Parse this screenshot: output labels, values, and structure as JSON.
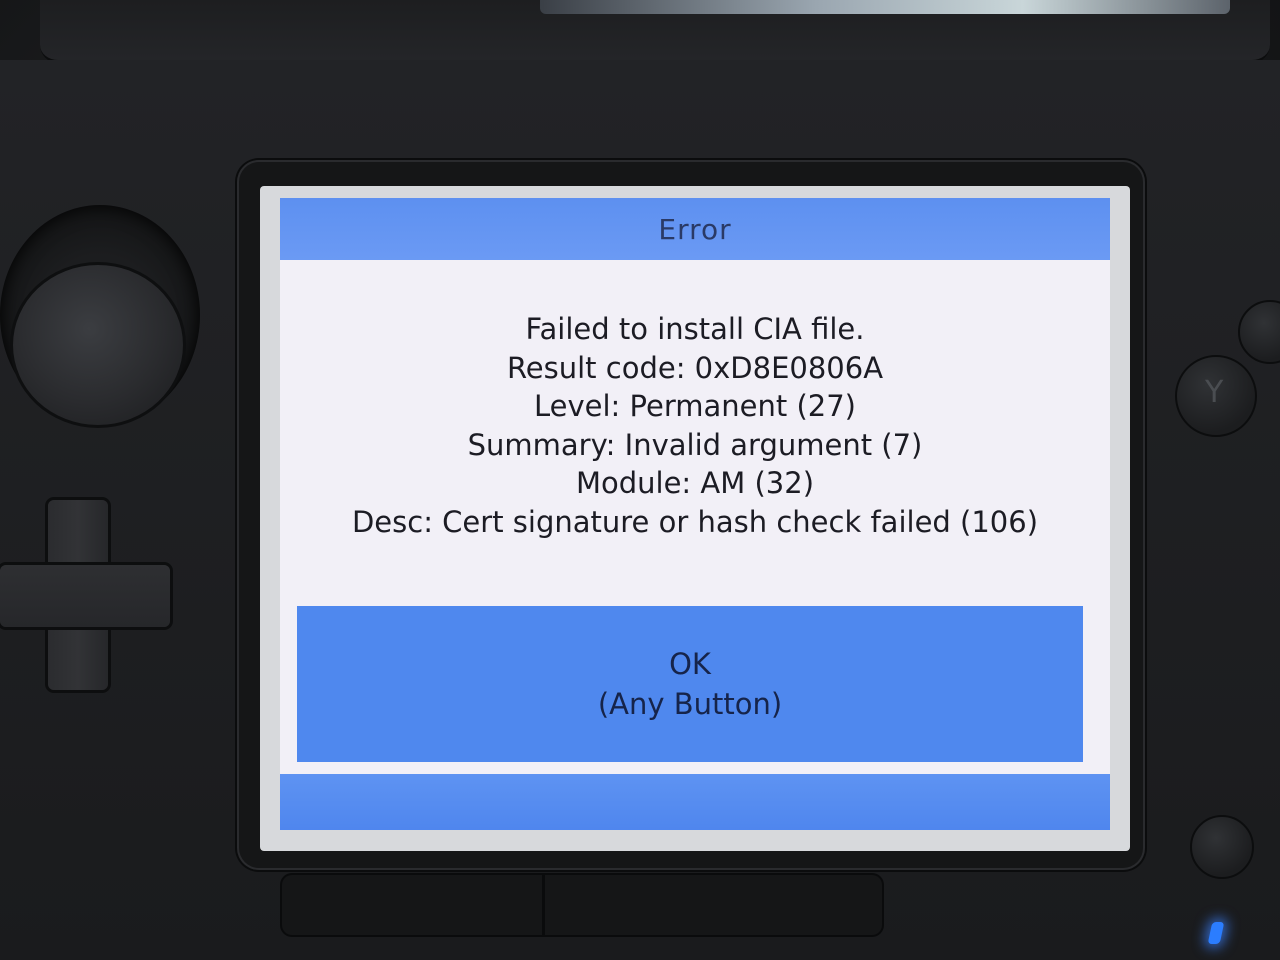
{
  "dialog": {
    "title": "Error",
    "lines": [
      "Failed to install CIA file.",
      "Result code: 0xD8E0806A",
      "Level: Permanent (27)",
      "Summary: Invalid argument (7)",
      "Module: AM (32)",
      "Desc: Cert signature or hash check failed (106)"
    ],
    "ok_label": "OK",
    "ok_hint": "(Any Button)"
  },
  "device": {
    "y_button_label": "Y"
  },
  "colors": {
    "title_bar": "#6b9af4",
    "dialog_bg": "#f2f0f7",
    "ok_button": "#4f88ee",
    "power_led": "#2b7dff"
  }
}
